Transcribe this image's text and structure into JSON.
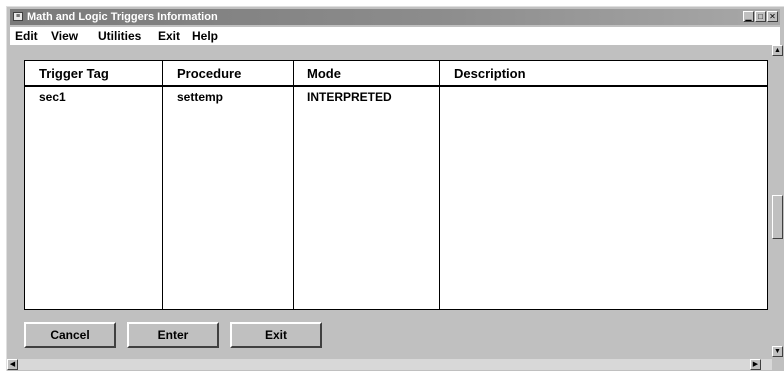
{
  "window": {
    "title": "Math and Logic Triggers Information"
  },
  "menu": [
    {
      "label": "Edit"
    },
    {
      "label": "View"
    },
    {
      "label": "Utilities"
    },
    {
      "label": "Exit"
    },
    {
      "label": "Help"
    }
  ],
  "table": {
    "columns": [
      "Trigger Tag",
      "Procedure",
      "Mode",
      "Description"
    ],
    "rows": [
      [
        "sec1",
        "settemp",
        "INTERPRETED",
        ""
      ]
    ]
  },
  "buttons": {
    "cancel": "Cancel",
    "enter": "Enter",
    "exit": "Exit"
  },
  "icons": {
    "app": "app-icon",
    "minimize": "minimize-icon",
    "maximize": "maximize-icon",
    "close": "close-icon",
    "scroll_up": "arrow-up-icon",
    "scroll_down": "arrow-down-icon",
    "scroll_left": "arrow-left-icon",
    "scroll_right": "arrow-right-icon"
  }
}
